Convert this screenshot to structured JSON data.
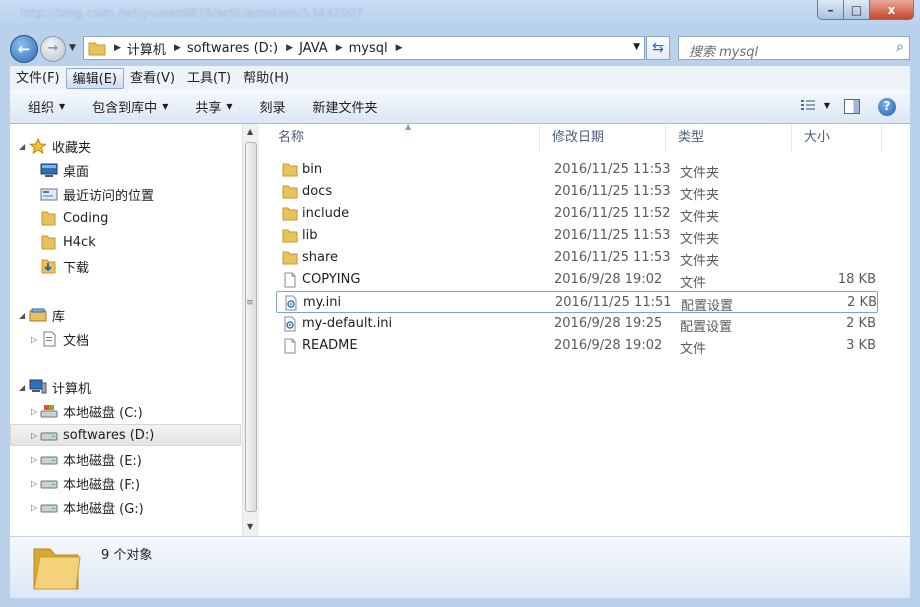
{
  "titlebar": {
    "blurred_text": "http://blog.csdn.net/yuxiao9876/article/details/53432007",
    "min": "–",
    "max": "□",
    "close": "x"
  },
  "address": {
    "back_glyph": "←",
    "forward_glyph": "→",
    "crumbs": [
      "计算机",
      "softwares (D:)",
      "JAVA",
      "mysql"
    ],
    "sep": "▶",
    "dropdown": "▼",
    "refresh_glyph": "⇆"
  },
  "search": {
    "placeholder": "搜索 mysql",
    "icon": "⌕"
  },
  "menu": [
    {
      "label": "文件(F)"
    },
    {
      "label": "编辑(E)"
    },
    {
      "label": "查看(V)"
    },
    {
      "label": "工具(T)"
    },
    {
      "label": "帮助(H)"
    }
  ],
  "commands": {
    "organize": "组织",
    "include_library": "包含到库中",
    "share": "共享",
    "burn": "刻录",
    "new_folder": "新建文件夹",
    "caret": "▼",
    "help": "?"
  },
  "nav": {
    "favorites": "收藏夹",
    "desktop": "桌面",
    "recent": "最近访问的位置",
    "coding": "Coding",
    "h4ck": "H4ck",
    "downloads": "下载",
    "libraries": "库",
    "documents": "文档",
    "computer": "计算机",
    "drive_c": "本地磁盘 (C:)",
    "drive_d": "softwares (D:)",
    "drive_e": "本地磁盘 (E:)",
    "drive_f": "本地磁盘 (F:)",
    "drive_g": "本地磁盘 (G:)",
    "expanded": "◢",
    "collapsed": "▷"
  },
  "columns": {
    "name": "名称",
    "modified": "修改日期",
    "type": "类型",
    "size": "大小"
  },
  "files": [
    {
      "name": "bin",
      "date": "2016/11/25 11:53",
      "type": "文件夹",
      "size": "",
      "kind": "folder"
    },
    {
      "name": "docs",
      "date": "2016/11/25 11:53",
      "type": "文件夹",
      "size": "",
      "kind": "folder"
    },
    {
      "name": "include",
      "date": "2016/11/25 11:52",
      "type": "文件夹",
      "size": "",
      "kind": "folder"
    },
    {
      "name": "lib",
      "date": "2016/11/25 11:53",
      "type": "文件夹",
      "size": "",
      "kind": "folder"
    },
    {
      "name": "share",
      "date": "2016/11/25 11:53",
      "type": "文件夹",
      "size": "",
      "kind": "folder"
    },
    {
      "name": "COPYING",
      "date": "2016/9/28 19:02",
      "type": "文件",
      "size": "18 KB",
      "kind": "file"
    },
    {
      "name": "my.ini",
      "date": "2016/11/25 11:51",
      "type": "配置设置",
      "size": "2 KB",
      "kind": "ini"
    },
    {
      "name": "my-default.ini",
      "date": "2016/9/28 19:25",
      "type": "配置设置",
      "size": "2 KB",
      "kind": "ini"
    },
    {
      "name": "README",
      "date": "2016/9/28 19:02",
      "type": "文件",
      "size": "3 KB",
      "kind": "file"
    }
  ],
  "status": {
    "count": "9 个对象"
  },
  "colors": {
    "folder": "#e8c25a",
    "accent": "#2a69b5",
    "selection_border": "#7da2ce"
  }
}
